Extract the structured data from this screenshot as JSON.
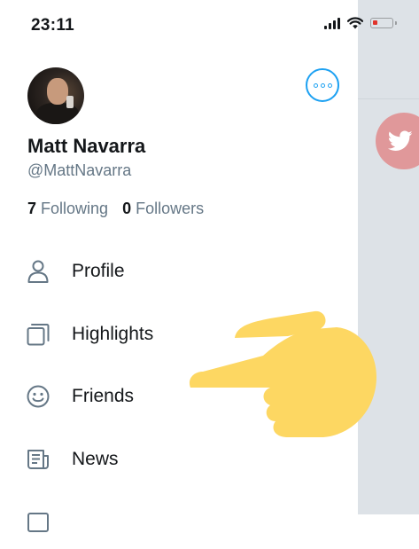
{
  "status_bar": {
    "time": "23:11",
    "icons": [
      "signal-icon",
      "wifi-icon",
      "battery-low-icon"
    ],
    "battery_color": "#e0332b"
  },
  "profile": {
    "name": "Matt Navarra",
    "handle": "@MattNavarra",
    "following_count": "7",
    "following_label": "Following",
    "followers_count": "0",
    "followers_label": "Followers"
  },
  "menu": {
    "items": [
      {
        "label": "Profile",
        "icon": "person-icon"
      },
      {
        "label": "Highlights",
        "icon": "highlights-icon"
      },
      {
        "label": "Friends",
        "icon": "smiley-icon"
      },
      {
        "label": "News",
        "icon": "news-icon"
      }
    ]
  },
  "colors": {
    "accent": "#1da1f2",
    "text": "#14171a",
    "secondary_text": "#657786",
    "side_panel": "#dde2e7",
    "twitter_circle": "#e0989a",
    "pointing_hand": "#fdd762"
  }
}
